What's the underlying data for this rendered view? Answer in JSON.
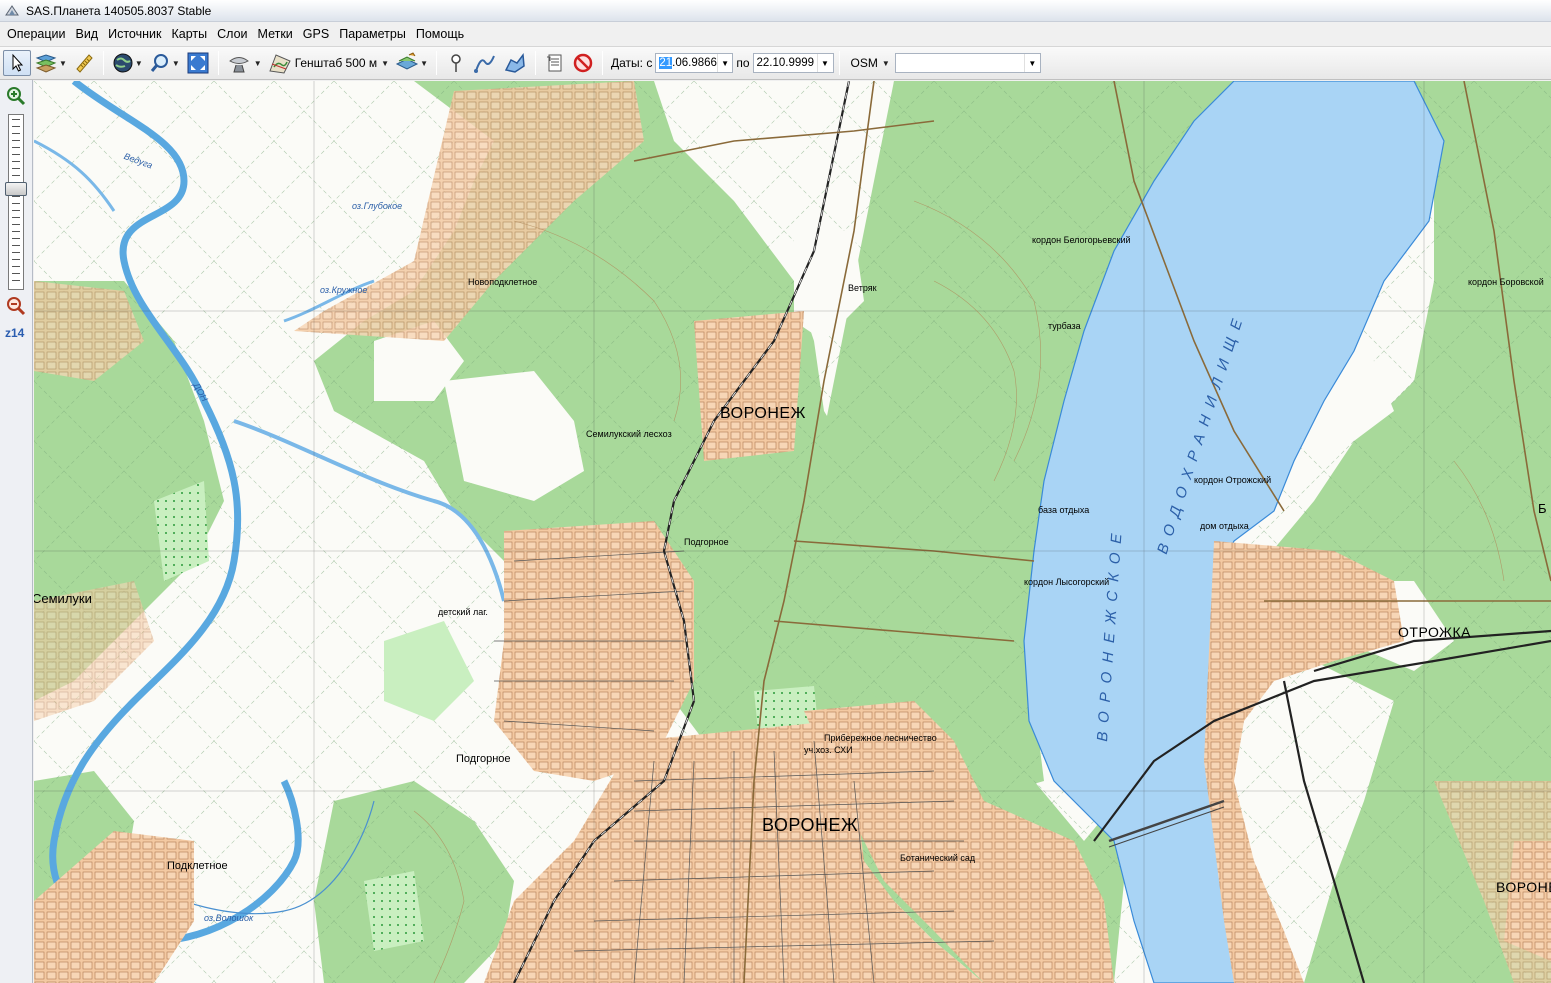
{
  "window": {
    "title": "SAS.Планета 140505.8037 Stable"
  },
  "menu": [
    "Операции",
    "Вид",
    "Источник",
    "Карты",
    "Слои",
    "Метки",
    "GPS",
    "Параметры",
    "Помощь"
  ],
  "toolbar": {
    "map_name": "Генштаб 500 м",
    "dates_label": "Даты: с",
    "date_from_selected": "21",
    "date_from_rest": ".06.9866",
    "to_label": "по",
    "date_to": "22.10.9999",
    "source": "OSM",
    "search_value": ""
  },
  "zoom": {
    "label": "z14"
  },
  "map": {
    "labels": {
      "voronezh_1": "ВОРОНЕЖ",
      "voronezh_2": "ВОРОНЕЖ",
      "voronezh_3": "ВОРОНЕ",
      "otrozhka": "ОТРОЖКА",
      "semiluki": "Семилуки",
      "podgornoe_1": "Подгорное",
      "podgornoe_2": "Подгорное",
      "podkletnoe": "Подклетное",
      "novopodkletnoe": "Новоподклетное",
      "semiluksky": "Семилукский лесхоз",
      "vetryak": "Ветряк",
      "reservoir_a": "ВОРОНЕЖСКОЕ",
      "reservoir_b": "ВОДОХРАНИЛИЩЕ",
      "don": "ДОН",
      "oz_glubokoe": "оз.Глубокое",
      "oz_kruzhnoe": "оз.Кружное",
      "oz_voloshok": "оз.Волошок",
      "veduga": "Ведуга",
      "kordon_belogorievsky": "кордон Белогорьевский",
      "kordon_otrozhsky": "кордон Отрожский",
      "kordon_lysogorsky": "кордон Лысогорский",
      "kordon_borovskoy": "кордон Боровской",
      "baza_otdykha": "база отдыха",
      "kurbaza": "турбаза",
      "prim_lesnichestvo": "Прибережное лесничество",
      "uch_hoz_shi": "уч.хоз. СХИ",
      "botanichesky_sad": "Ботанический сад",
      "dom_otdykha": "дом отдыха",
      "detsky_lager": "детский лаг.",
      "b_chernaya": "Б"
    }
  }
}
